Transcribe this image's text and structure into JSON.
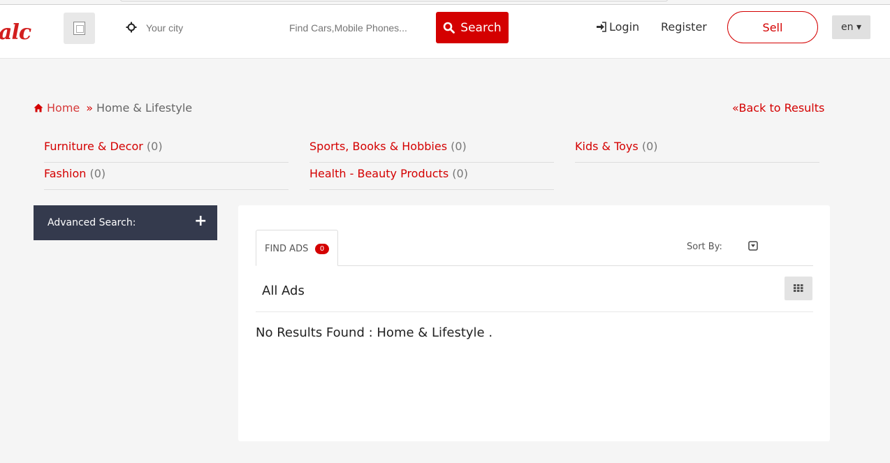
{
  "header": {
    "logo_text": "alc",
    "city_placeholder": "Your city",
    "find_placeholder": "Find Cars,Mobile Phones...",
    "search_label": "Search",
    "login_label": "Login",
    "register_label": "Register",
    "sell_label": "Sell",
    "lang_label": "en ▾"
  },
  "breadcrumb": {
    "home": "Home",
    "separator": "»",
    "current": "Home & Lifestyle"
  },
  "back_link": "«Back to Results",
  "categories": [
    {
      "name": "Furniture & Decor",
      "count": "(0)"
    },
    {
      "name": "Sports, Books & Hobbies",
      "count": "(0)"
    },
    {
      "name": "Kids & Toys",
      "count": "(0)"
    },
    {
      "name": "Fashion",
      "count": "(0)"
    },
    {
      "name": "Health - Beauty Products",
      "count": "(0)"
    }
  ],
  "advanced_search": {
    "label": "Advanced Search:",
    "toggle": "+"
  },
  "results": {
    "tab_label": "FIND ADS",
    "tab_badge": "0",
    "sort_label": "Sort By:",
    "heading": "All Ads",
    "empty_message": "No Results Found : Home & Lifestyle ."
  },
  "colors": {
    "accent": "#d40000",
    "sidebar": "#343a4d",
    "background": "#f5f5f5"
  }
}
